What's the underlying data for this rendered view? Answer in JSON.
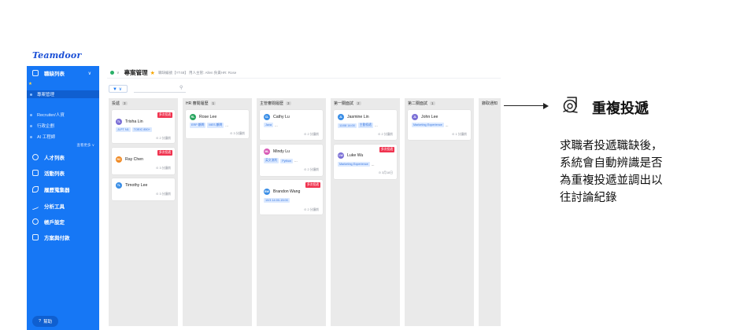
{
  "app": {
    "logo": "Teamdoor"
  },
  "sidebar": {
    "jobs_label": "職缺列表",
    "star_label": "★",
    "project_mgmt": "專案管理",
    "recruiter": "Recruiter/人資",
    "hiring_manager": "行政企劃",
    "ai_engineer": "AI 工程師",
    "show_more": "查看更多 ∨",
    "talent": "人才列表",
    "events": "活動列表",
    "collector": "履歷蒐集器",
    "analytics": "分析工具",
    "account": "帳戶設定",
    "billing": "方案與付款",
    "help": "幫助"
  },
  "header": {
    "title": "專案管理",
    "meta": "職缺編號【YT48】 用人主管: Allen 負責HR: Rose"
  },
  "toolbar": {
    "filter_label": "▼ ∨",
    "search_placeholder": ""
  },
  "columns": [
    {
      "name": "投遞",
      "count": "3"
    },
    {
      "name": "HR 審閱履歷",
      "count": "1"
    },
    {
      "name": "主管審閱履歷",
      "count": "3"
    },
    {
      "name": "第一關面試",
      "count": "2"
    },
    {
      "name": "第二關面試",
      "count": "1"
    },
    {
      "name": "錄取通知",
      "count": ""
    }
  ],
  "cards": {
    "c1": {
      "initials": "TL",
      "name": "Trisha Lin",
      "badge": "多次投遞",
      "tags": [
        "JLPT N1",
        "TOEIC 850+"
      ],
      "time": "2 分鐘前",
      "color": "#7b6fd6"
    },
    "c2": {
      "initials": "RC",
      "name": "Ray Chen",
      "badge": "多次投遞",
      "time": "3 分鐘前",
      "color": "#f08a24"
    },
    "c3": {
      "initials": "TL",
      "name": "Timothy Lee",
      "time": "3 分鐘前",
      "color": "#3a8ee6"
    },
    "c4": {
      "initials": "RL",
      "name": "Rose Lee",
      "tags": [
        "ERP 顧問",
        "MES 顧問"
      ],
      "more": "...",
      "time": "3 分鐘前",
      "color": "#28a55f"
    },
    "c5": {
      "initials": "CL",
      "name": "Cathy Lu",
      "tags": [
        "Java"
      ],
      "more": "...",
      "time": "2 分鐘前",
      "color": "#3a8ee6"
    },
    "c6": {
      "initials": "ML",
      "name": "Mindy Lu",
      "tags": [
        "英文流利",
        "Python"
      ],
      "more": "...",
      "time": "2 分鐘前",
      "color": "#d85bb6"
    },
    "c7": {
      "initials": "BW",
      "name": "Brandon Wang",
      "badge": "多次投遞",
      "tags": [
        "10/3 14:00-15:00"
      ],
      "time": "2 分鐘前",
      "color": "#3a8ee6"
    },
    "c8": {
      "initials": "JL",
      "name": "Jasmine Lin",
      "tags": [
        "11/08 14:00",
        "主動投遞"
      ],
      "more": "...",
      "time": "2 分鐘前",
      "color": "#3a8ee6"
    },
    "c9": {
      "initials": "LW",
      "name": "Luke Wu",
      "badge": "多次投遞",
      "tags": [
        "Marketing Experience"
      ],
      "more": "...",
      "time": "3月18日",
      "color": "#7b6fd6"
    },
    "c10": {
      "initials": "JL",
      "name": "John Lee",
      "tags": [
        "Marketing Experience"
      ],
      "more": "...",
      "time": "1 分鐘前",
      "color": "#7b6fd6"
    }
  },
  "feature": {
    "title": "重複投遞",
    "lines": [
      "求職者投遞職缺後，",
      "系統會自動辨識是否",
      "為重複投遞並調出以",
      "往討論紀錄"
    ]
  },
  "colors": {
    "sidebar": "#1677f5",
    "badge": "#f0334f",
    "tag_bg": "#dbe9ff"
  }
}
